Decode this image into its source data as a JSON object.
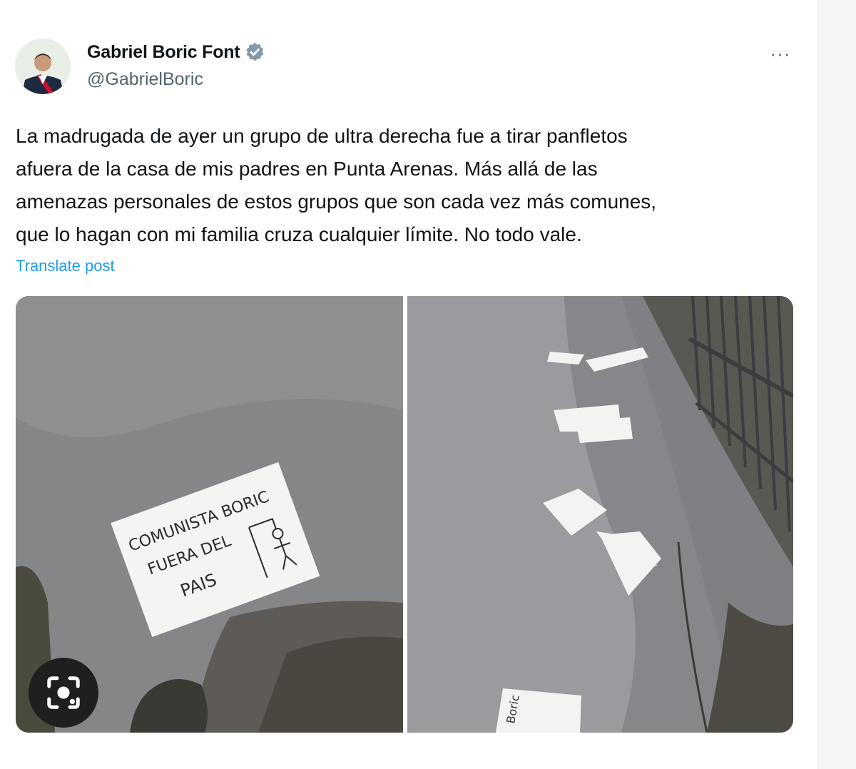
{
  "post": {
    "author": {
      "display_name": "Gabriel Boric Font",
      "handle": "@GabrielBoric",
      "verified_icon": "verified-badge-icon",
      "avatar_icon": "avatar"
    },
    "more_label": "···",
    "text": "La madrugada de ayer un grupo de ultra derecha fue a tirar panfletos\nafuera de la casa de mis padres en Punta Arenas. Más allá de las\namenazas personales de estos grupos que son cada vez más comunes,\nque lo hagan con mi familia cruza cualquier límite. No todo vale.",
    "translate_label": "Translate post",
    "media": {
      "left_note_text": [
        "COMUNISTA BORIC",
        "FUERA DEL",
        "PAIS"
      ],
      "right_note_text": "Boric"
    }
  },
  "colors": {
    "link": "#1d9bf0",
    "verified": "#829aab",
    "secondary_text": "#536471"
  },
  "lens": {
    "icon": "image-search-icon"
  }
}
